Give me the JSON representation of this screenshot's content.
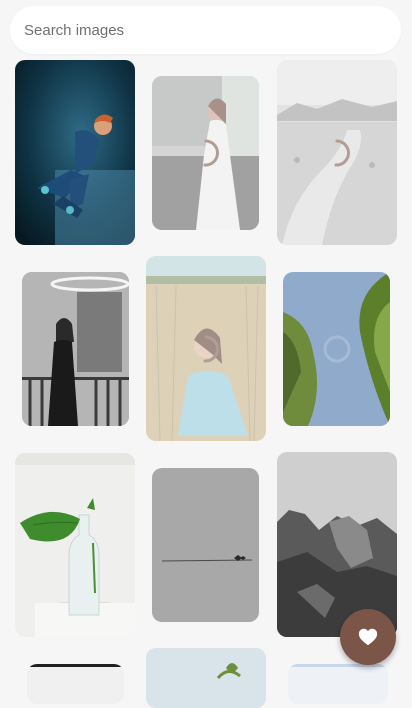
{
  "search": {
    "placeholder": "Search images",
    "value": ""
  },
  "grid": {
    "tiles": [
      {
        "name": "image-tile-portrait-blue",
        "state": "loaded"
      },
      {
        "name": "image-tile-woman-white-dress",
        "state": "loading"
      },
      {
        "name": "image-tile-mountain-road",
        "state": "loading"
      },
      {
        "name": "image-tile-woman-balcony",
        "state": "loaded"
      },
      {
        "name": "image-tile-woman-field",
        "state": "loading"
      },
      {
        "name": "image-tile-trees-sky",
        "state": "loading"
      },
      {
        "name": "image-tile-plant-vase",
        "state": "loaded"
      },
      {
        "name": "image-tile-birds-wire",
        "state": "loaded"
      },
      {
        "name": "image-tile-rock-cliffs",
        "state": "loaded"
      },
      {
        "name": "image-tile-dark-bottom",
        "state": "partial"
      },
      {
        "name": "image-tile-plant-bottom",
        "state": "partial"
      },
      {
        "name": "image-tile-blue-bottom",
        "state": "partial"
      }
    ]
  },
  "colors": {
    "accent": "#7a5548",
    "spinner": "#7a5548",
    "background": "#f6f6f6"
  },
  "fab": {
    "icon": "heart-icon"
  }
}
